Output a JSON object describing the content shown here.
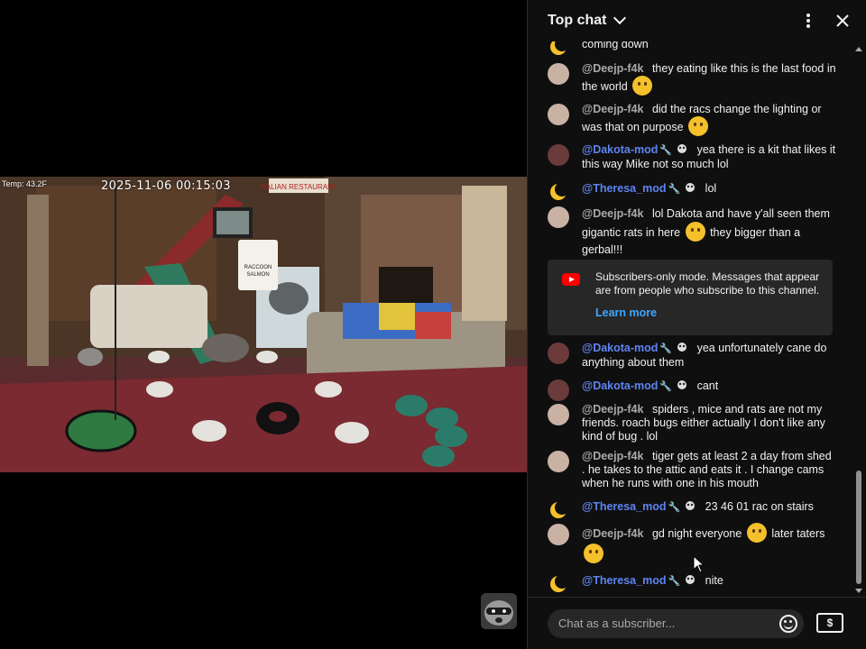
{
  "video": {
    "temp": "Temp: 43.2F",
    "timestamp": "2025-11-06 00:15:03",
    "sign_restaurant": "ITALIAN RESTAURANT",
    "bucket_label": "RACCOON SALMON"
  },
  "chat": {
    "title": "Top chat",
    "messages": [
      {
        "author": "",
        "text": "coming down",
        "avatar": "moon"
      },
      {
        "author": "@Deejp-f4k",
        "text": "they eating like this is the last food in the world",
        "emoji": "laughing-emoji"
      },
      {
        "author": "@Deejp-f4k",
        "text": "did the racs change the lighting or was that on purpose",
        "emoji": "thinking-emoji"
      },
      {
        "author": "@Dakota-mod",
        "text": "yea there is a kit that likes it this way Mike not so much lol",
        "moderator": true
      },
      {
        "author": "@Theresa_mod",
        "text": "lol",
        "moderator": true
      },
      {
        "author": "@Deejp-f4k",
        "text_a": "lol Dakota and have y'all seen them gigantic rats in here",
        "text_b": "they bigger than a gerbal!!!",
        "emoji": "flushed-emoji"
      },
      {
        "author": "@Dakota-mod",
        "text": "yea unfortunately cane do anything about them",
        "moderator": true
      },
      {
        "author": "@Dakota-mod",
        "text": "cant",
        "moderator": true
      },
      {
        "author": "@Deejp-f4k",
        "text": "spiders , mice and rats are not my friends. roach bugs either actually I don't like any kind of bug . lol"
      },
      {
        "author": "@Deejp-f4k",
        "text": "tiger gets at least 2 a day from shed . he takes to the attic and eats it . I change cams when he runs with one in his mouth"
      },
      {
        "author": "@Theresa_mod",
        "text": "23 46 01 rac on stairs",
        "moderator": true
      },
      {
        "author": "@Deejp-f4k",
        "text_a": "gd night everyone",
        "text_b": "later taters",
        "emoji": "yawning-emoji"
      },
      {
        "author": "@Theresa_mod",
        "text": "nite",
        "moderator": true
      }
    ],
    "notice": {
      "text": "Subscribers-only mode. Messages that appear are from people who subscribe to this channel.",
      "link": "Learn more"
    },
    "input_placeholder": "Chat as a subscriber..."
  }
}
